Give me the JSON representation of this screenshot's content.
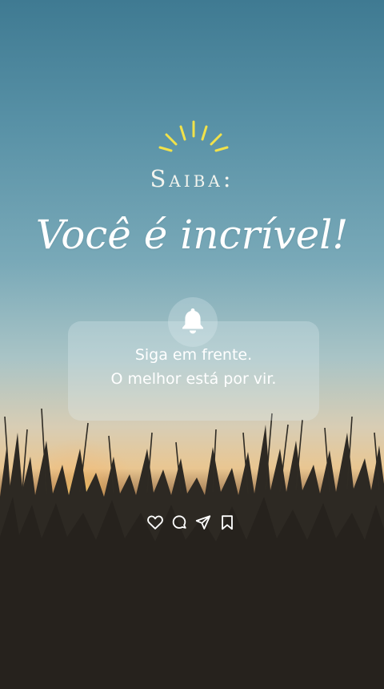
{
  "heading": {
    "kicker": "Saiba:",
    "title": "Você é incrível!"
  },
  "message": {
    "line1": "Siga em frente.",
    "line2": "O melhor está por vir."
  },
  "icons": {
    "decoration": "sun-rays-icon",
    "notification": "bell-icon",
    "actions": [
      "heart-icon",
      "comment-icon",
      "send-icon",
      "bookmark-icon"
    ]
  },
  "colors": {
    "sky_top": "#3f7a92",
    "sky_mid": "#79a9b8",
    "horizon": "#e9c691",
    "ground": "#2b2620",
    "rays": "#f1e24a",
    "text": "#ffffff"
  }
}
